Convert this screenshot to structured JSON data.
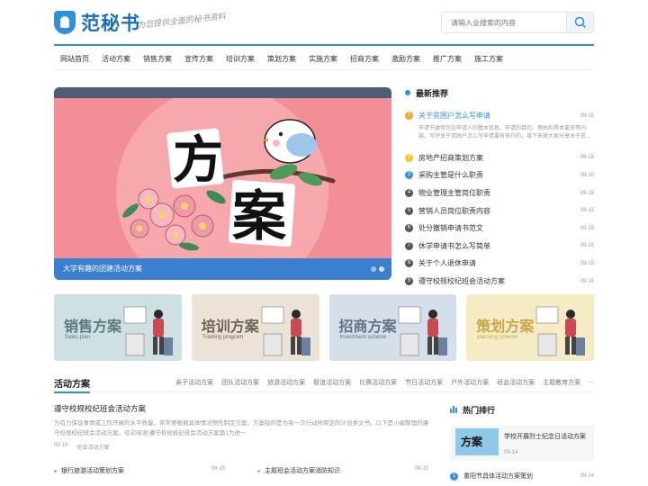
{
  "header": {
    "logo_text": "范秘书",
    "slogan": "为您提供全面的秘书资料",
    "search_placeholder": "请输入业搜索的内容"
  },
  "nav": [
    "网站首页",
    "活动方案",
    "销售方案",
    "宣传方案",
    "培训方案",
    "策划方案",
    "实施方案",
    "招商方案",
    "激励方案",
    "推广方案",
    "施工方案"
  ],
  "banner": {
    "caption": "大学有趣的团建活动方案",
    "art_text_1": "方",
    "art_text_2": "案"
  },
  "latest": {
    "title": "最新推荐",
    "items": [
      {
        "num": "1",
        "title": "关于贫困户怎么写申请",
        "date": "09-15",
        "desc": "申请书通常包括申请人的基本信息、申请的目的、理由和具体要求等内容。写好关于贫困户怎么写申请要有技巧的，接下来就大家分享关于贫..."
      },
      {
        "num": "2",
        "title": "房地产招商策划方案",
        "date": "09-15"
      },
      {
        "num": "3",
        "title": "采购主管是什么职责",
        "date": "09-15"
      },
      {
        "num": "4",
        "title": "物业管理主管岗位职责",
        "date": "09-15"
      },
      {
        "num": "5",
        "title": "营销人员岗位职责内容",
        "date": "09-15"
      },
      {
        "num": "6",
        "title": "处分撤销申请书范文",
        "date": "09-15"
      },
      {
        "num": "7",
        "title": "休学申请书怎么写简单",
        "date": "09-15"
      },
      {
        "num": "8",
        "title": "关于个人退休申请",
        "date": "09-15"
      },
      {
        "num": "9",
        "title": "遵守校规校纪班会活动方案",
        "date": "09-15"
      }
    ]
  },
  "cards": [
    {
      "title": "销售方案",
      "sub": "Sales plan",
      "bg": "#cfe0e3",
      "color": "#5b7a80"
    },
    {
      "title": "培训方案",
      "sub": "Training program",
      "bg": "#ebe3d6",
      "color": "#6b6458"
    },
    {
      "title": "招商方案",
      "sub": "Investment scheme",
      "bg": "#d4dfe9",
      "color": "#5f7388"
    },
    {
      "title": "策划方案",
      "sub": "planning scheme",
      "bg": "#f5ecc6",
      "color": "#c9a64a"
    }
  ],
  "activity": {
    "title": "活动方案",
    "tags": [
      "亲子活动方案",
      "团队活动方案",
      "旅游活动方案",
      "联谊活动方案",
      "比赛活动方案",
      "节日活动方案",
      "户外活动方案",
      "班会活动方案",
      "主题教育方案",
      "..."
    ],
    "feature": {
      "title": "遵守校规校纪班会活动方案",
      "desc": "为有力保证事情或工作开展的水平质量，常常要根据具体情况预先制定方案，方案指的是为某一次行动所制定的计划类文书。以下是小编整理的遵守校规校纪班会活动方案，欢迎阅读!遵守校规校纪班会活动方案篇1为进一",
      "date": "09-15",
      "category": "班会活动方案"
    },
    "rows": [
      {
        "title": "银行旅游活动策划方案",
        "date": "09-15"
      },
      {
        "title": "主题班会活动方案消防知识",
        "date": "09-15"
      }
    ]
  },
  "hot": {
    "title": "热门排行",
    "top": {
      "title": "学校开展烈士纪念日活动方案",
      "date": "09-14",
      "thumb_text": "方案"
    },
    "items": [
      {
        "num": "1",
        "title": "重阳节具体活动方案策划",
        "date": "09-14"
      }
    ]
  },
  "colors": {
    "accent": "#2f8fd8",
    "banner_bg": "#f28e96",
    "caption_bg": "#3a7fd0"
  }
}
